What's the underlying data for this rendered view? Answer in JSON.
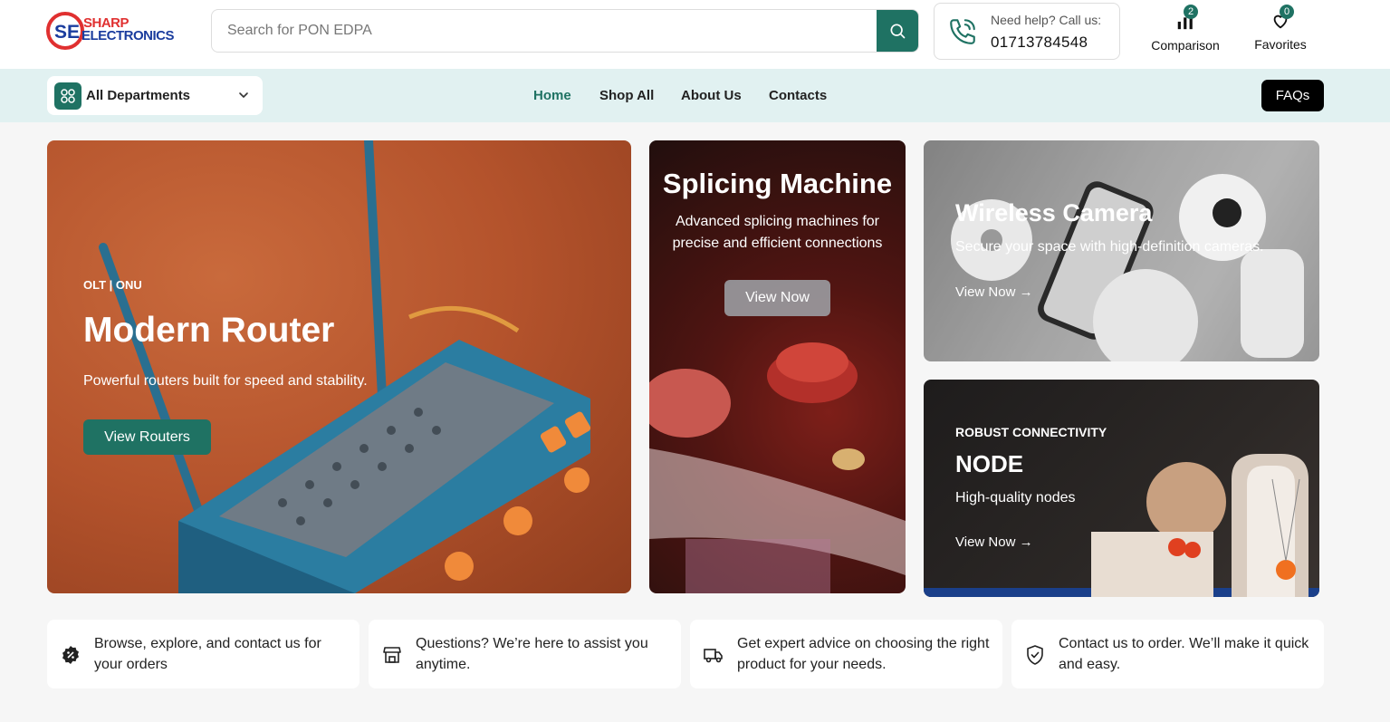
{
  "brand": {
    "line1": "SHARP",
    "line2": "ELECTRONICS",
    "primary_color": "#1f7263",
    "logo_red": "#e03030",
    "logo_blue": "#1b3d9e"
  },
  "search": {
    "placeholder": "Search for PON EDPA"
  },
  "help": {
    "label": "Need help? Call us:",
    "phone": "01713784548"
  },
  "header_actions": {
    "comparison": {
      "label": "Comparison",
      "count": "2"
    },
    "favorites": {
      "label": "Favorites",
      "count": "0"
    }
  },
  "nav": {
    "departments": "All Departments",
    "links": [
      "Home",
      "Shop All",
      "About Us",
      "Contacts"
    ],
    "active": "Home",
    "faq": "FAQs"
  },
  "banners": {
    "router": {
      "kicker": "OLT | ONU",
      "title": "Modern Router",
      "desc": "Powerful routers built for speed and stability.",
      "cta": "View Routers"
    },
    "splicing": {
      "title": "Splicing Machine",
      "desc": "Advanced splicing machines for precise and efficient connections",
      "cta": "View Now"
    },
    "camera": {
      "title": "Wireless Camera",
      "desc": "Secure your space with high-definition cameras.",
      "cta": "View Now →"
    },
    "node": {
      "kicker": "ROBUST CONNECTIVITY",
      "title": "NODE",
      "desc": "High-quality nodes",
      "cta": "View Now →"
    }
  },
  "features": [
    {
      "icon": "discount-badge-icon",
      "text": "Browse, explore, and contact us for your orders"
    },
    {
      "icon": "store-icon",
      "text": "Questions? We’re here to assist you anytime."
    },
    {
      "icon": "delivery-truck-icon",
      "text": "Get expert advice on choosing the right product for your needs."
    },
    {
      "icon": "shield-check-icon",
      "text": "Contact us to order. We’ll make it quick and easy."
    }
  ]
}
